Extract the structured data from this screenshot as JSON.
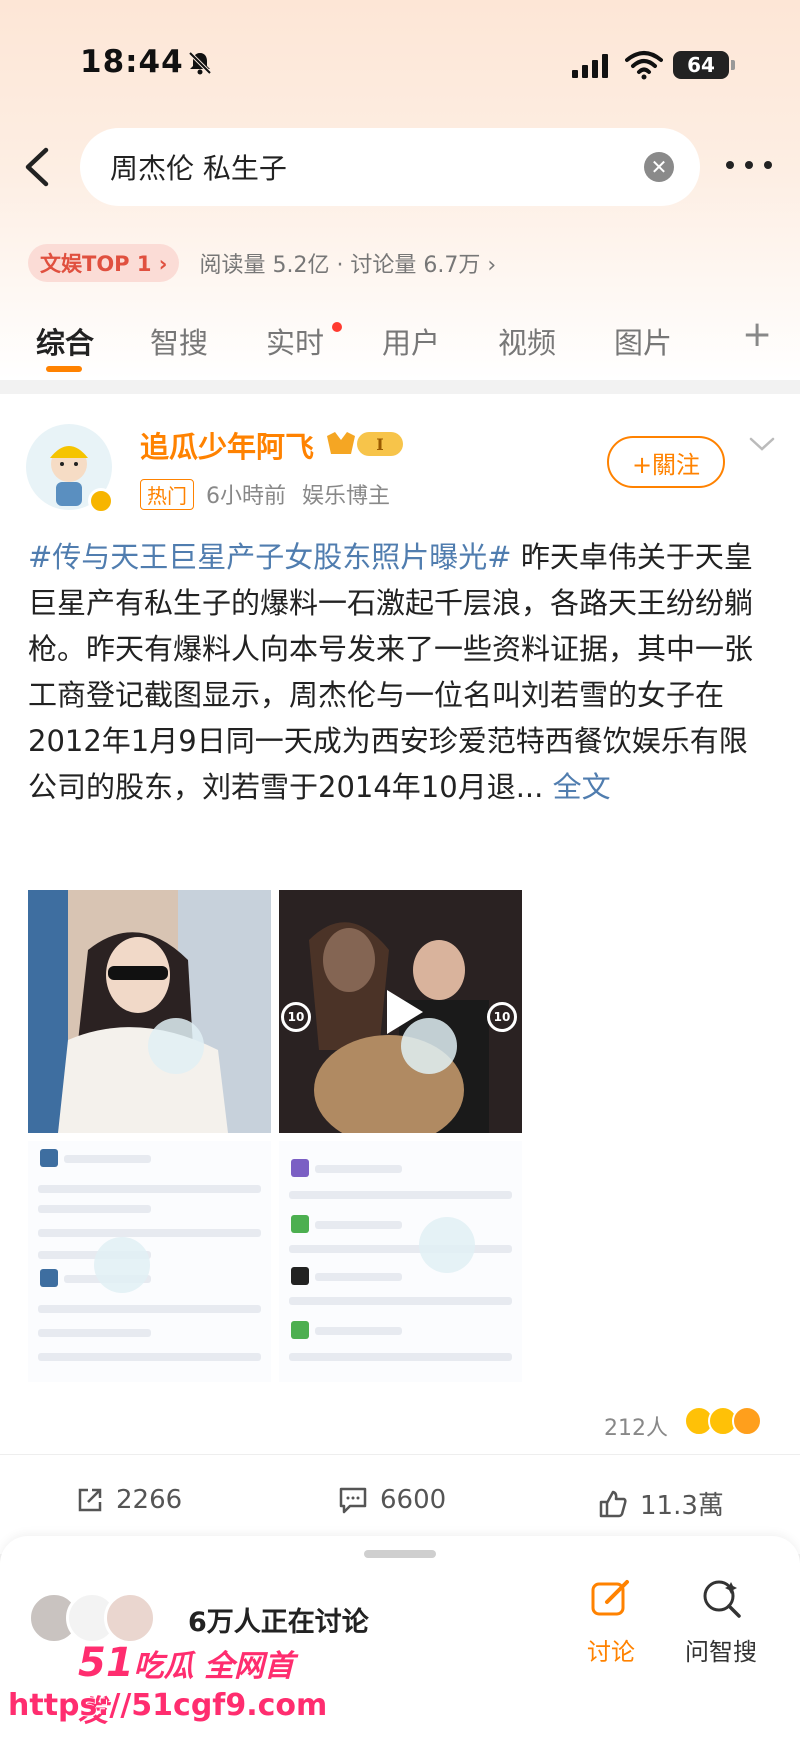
{
  "status_bar": {
    "time": "18:44",
    "battery": "64"
  },
  "search": {
    "query": "周杰伦 私生子"
  },
  "hot": {
    "badge": "文娱TOP 1 ›",
    "stats": "阅读量 5.2亿 · 讨论量 6.7万 ›"
  },
  "tabs": [
    "综合",
    "智搜",
    "实时",
    "用户",
    "视频",
    "图片"
  ],
  "post": {
    "author": "追瓜少年阿飞",
    "level_badge": "I",
    "hot_tag": "热门",
    "time": "6小時前",
    "category": "娱乐博主",
    "follow_label": "+關注",
    "topic": "#传与天王巨星产子女股东照片曝光#",
    "text": " 昨天卓伟关于天皇巨星产有私生子的爆料一石激起千层浪，各路天王纷纷躺枪。昨天有爆料人向本号发来了一些资料证据，其中一张工商登记截图显示，周杰伦与一位名叫刘若雪的女子在2012年1月9日同一天成为西安珍爱范特西餐饮娱乐有限公司的股东，刘若雪于2014年10月退...",
    "full_text_link": "全文",
    "reaction_count": "212人",
    "reposts": "2266",
    "comments": "6600",
    "likes": "11.3萬"
  },
  "bottom": {
    "discuss_text": "6万人正在讨论",
    "discuss_label": "讨论",
    "ask_label": "问智搜"
  },
  "watermark": {
    "line1_num": "51",
    "line1_text": "吃瓜 全网首发",
    "line2": "https://51cgf9.com"
  },
  "colors": {
    "accent": "#ff8200",
    "link": "#507daf",
    "hot_red": "#e0503f"
  }
}
